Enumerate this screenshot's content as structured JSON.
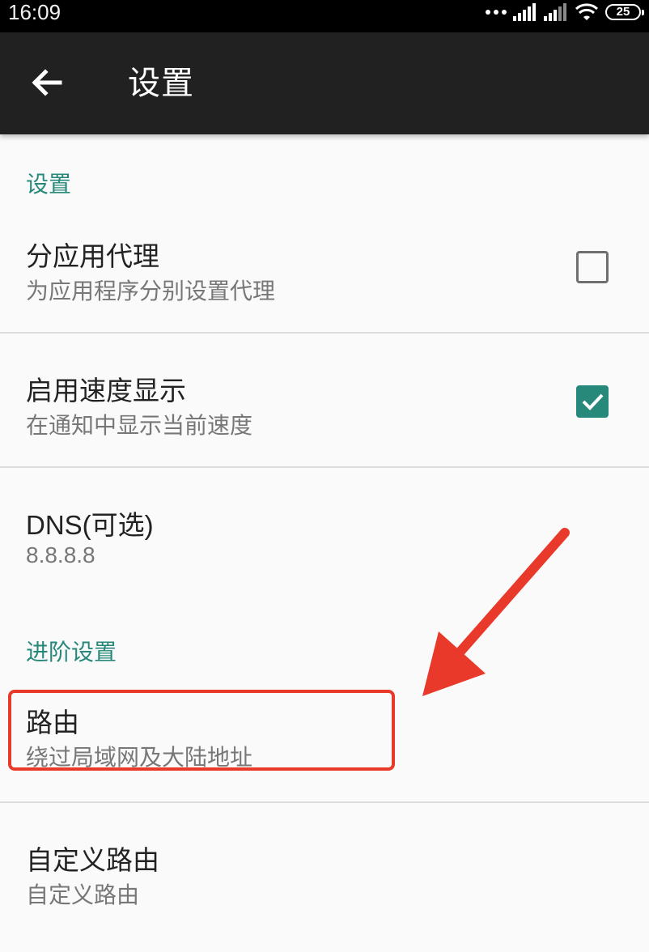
{
  "status_bar": {
    "time": "16:09",
    "battery": "25",
    "icons": [
      "more-dots-icon",
      "signal-icon",
      "signal-icon",
      "wifi-icon",
      "battery-icon"
    ]
  },
  "toolbar": {
    "title": "设置",
    "back_icon": "arrow-left-icon"
  },
  "sections": {
    "settings_header": "设置",
    "advanced_header": "进阶设置"
  },
  "prefs": {
    "per_app_proxy": {
      "title": "分应用代理",
      "summary": "为应用程序分别设置代理",
      "checked": false
    },
    "speed_display": {
      "title": "启用速度显示",
      "summary": "在通知中显示当前速度",
      "checked": true
    },
    "dns": {
      "title": "DNS(可选)",
      "summary": "8.8.8.8"
    },
    "route": {
      "title": "路由",
      "summary": "绕过局域网及大陆地址"
    },
    "custom_route": {
      "title": "自定义路由",
      "summary": "自定义路由"
    }
  },
  "colors": {
    "accent": "#26897a",
    "toolbar": "#212121",
    "annotation": "#e8392a"
  }
}
